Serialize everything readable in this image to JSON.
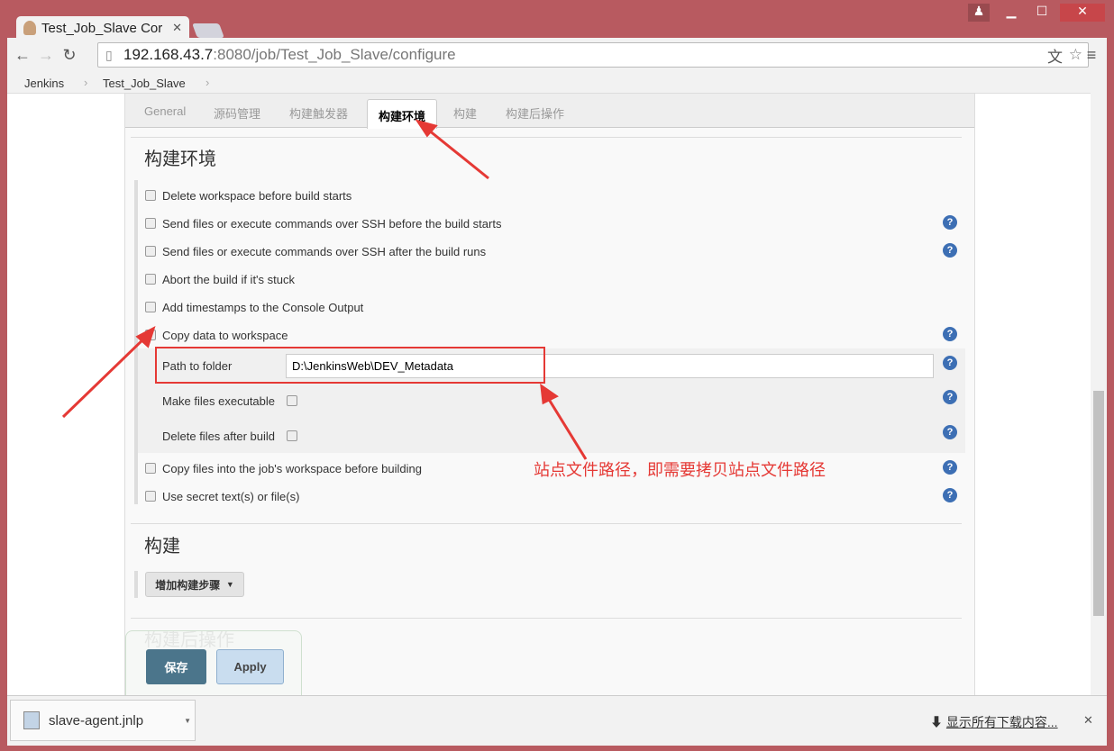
{
  "browser": {
    "tab_title": "Test_Job_Slave Cor",
    "url_host": "192.168.43.7",
    "url_rest": ":8080/job/Test_Job_Slave/configure"
  },
  "breadcrumb": [
    "Jenkins",
    "Test_Job_Slave"
  ],
  "tabs": [
    "General",
    "源码管理",
    "构建触发器",
    "构建环境",
    "构建",
    "构建后操作"
  ],
  "active_tab": "构建环境",
  "section_env": {
    "title": "构建环境",
    "options": [
      {
        "label": "Delete workspace before build starts",
        "checked": false
      },
      {
        "label": "Send files or execute commands over SSH before the build starts",
        "checked": false
      },
      {
        "label": "Send files or execute commands over SSH after the build runs",
        "checked": false
      },
      {
        "label": "Abort the build if it's stuck",
        "checked": false
      },
      {
        "label": "Add timestamps to the Console Output",
        "checked": false
      },
      {
        "label": "Copy data to workspace",
        "checked": true
      },
      {
        "label": "Copy files into the job's workspace before building",
        "checked": false
      },
      {
        "label": "Use secret text(s) or file(s)",
        "checked": false
      }
    ],
    "path_label": "Path to folder",
    "path_value": "D:\\JenkinsWeb\\DEV_Metadata",
    "make_exec_label": "Make files executable",
    "delete_after_label": "Delete files after build"
  },
  "section_build": {
    "title": "构建",
    "add_step": "增加构建步骤"
  },
  "section_post": {
    "title": "构建后操作"
  },
  "buttons": {
    "save": "保存",
    "apply": "Apply"
  },
  "annotation": "站点文件路径，即需要拷贝站点文件路径",
  "downloads": {
    "file": "slave-agent.jnlp",
    "show_all": "显示所有下载内容..."
  },
  "colors": {
    "frame": "#b85a60",
    "save": "#4b758b",
    "help": "#3d6fb4",
    "annotation": "#e53935"
  }
}
